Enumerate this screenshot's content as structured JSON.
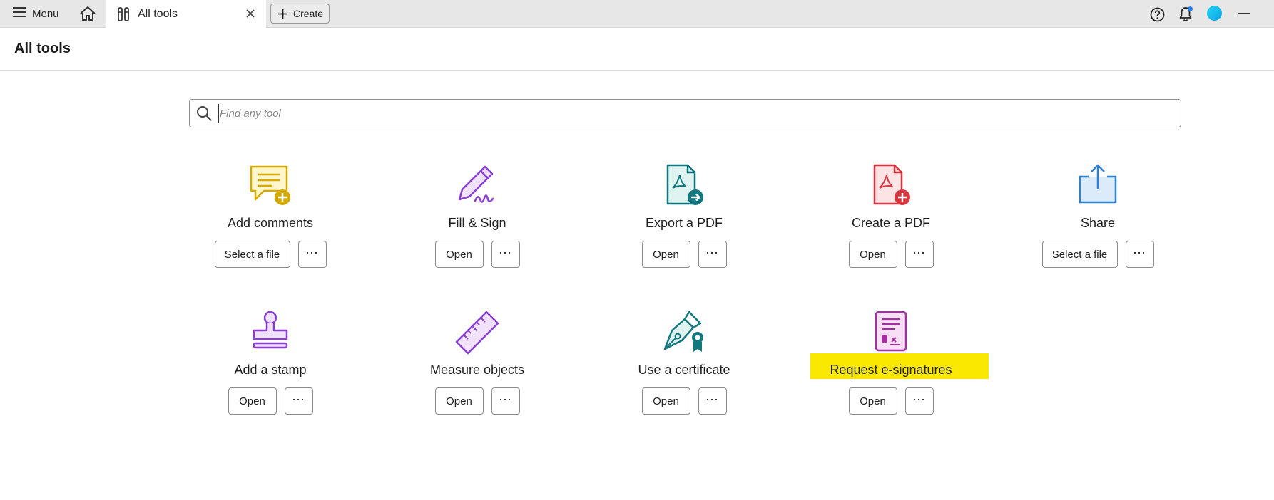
{
  "topbar": {
    "menu_label": "Menu",
    "tab_label": "All tools",
    "create_label": "Create"
  },
  "page": {
    "title": "All tools"
  },
  "search": {
    "placeholder": "Find any tool",
    "value": ""
  },
  "tools": [
    {
      "name": "Add comments",
      "primary": "Select a file",
      "icon": "comment-plus-icon",
      "color": "#d4a900"
    },
    {
      "name": "Fill & Sign",
      "primary": "Open",
      "icon": "pen-sign-icon",
      "color": "#8a3fd1"
    },
    {
      "name": "Export a PDF",
      "primary": "Open",
      "icon": "export-pdf-icon",
      "color": "#13777f"
    },
    {
      "name": "Create a PDF",
      "primary": "Open",
      "icon": "create-pdf-icon",
      "color": "#d7373f"
    },
    {
      "name": "Share",
      "primary": "Select a file",
      "icon": "share-upload-icon",
      "color": "#2f81d0"
    },
    {
      "name": "Add a stamp",
      "primary": "Open",
      "icon": "stamp-icon",
      "color": "#8a3fd1"
    },
    {
      "name": "Measure objects",
      "primary": "Open",
      "icon": "ruler-icon",
      "color": "#8a3fd1"
    },
    {
      "name": "Use a certificate",
      "primary": "Open",
      "icon": "certificate-pen-icon",
      "color": "#13777f"
    },
    {
      "name": "Request e-signatures",
      "primary": "Open",
      "icon": "request-esign-icon",
      "color": "#a32fa0"
    }
  ],
  "more_label": "⋯",
  "highlight_color": "#fbe800"
}
